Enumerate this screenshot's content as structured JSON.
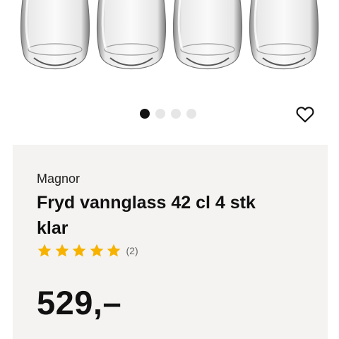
{
  "product": {
    "brand": "Magnor",
    "title": "Fryd vannglass 42 cl 4 stk klar",
    "rating": 5,
    "rating_max": 5,
    "review_count": "(2)",
    "price": "529,–"
  },
  "gallery": {
    "image_count": 4,
    "active_index": 0
  },
  "colors": {
    "star": "#f7b200",
    "card_bg": "#f4f3f1",
    "active_dot": "#111111",
    "inactive_dot": "#e6e6e6"
  },
  "icons": {
    "favorite": "heart-outline-icon",
    "rating": "star-icon"
  }
}
